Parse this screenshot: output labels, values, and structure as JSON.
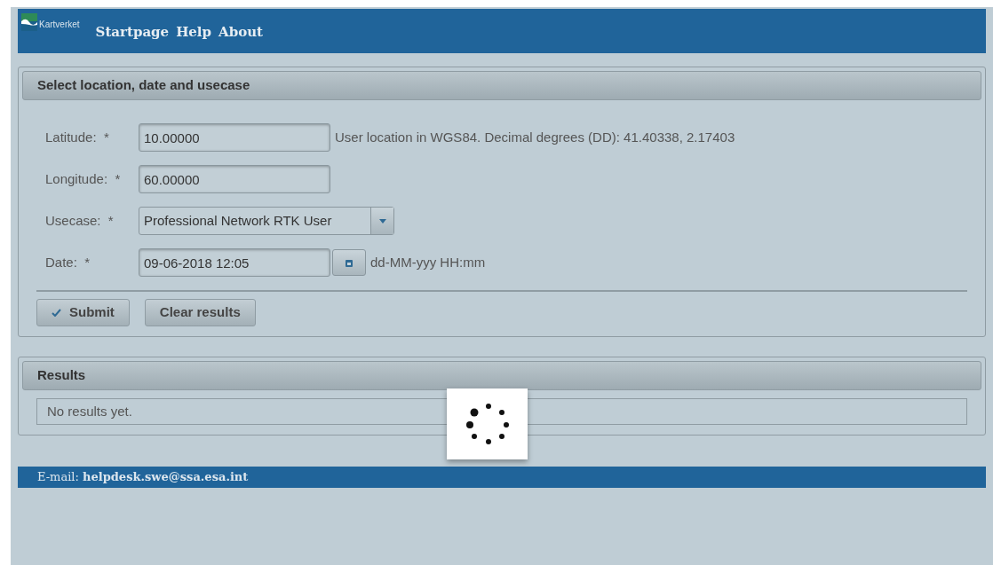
{
  "header": {
    "logo_text": "Kartverket",
    "nav": [
      "Startpage",
      "Help",
      "About"
    ]
  },
  "form_panel": {
    "title": "Select location, date and usecase",
    "fields": [
      {
        "kind": "text",
        "label": "Latitude:",
        "required_mark": "*",
        "value": "10.00000",
        "hint": "User location in WGS84. Decimal degrees (DD): 41.40338, 2.17403"
      },
      {
        "kind": "text",
        "label": "Longitude:",
        "required_mark": "*",
        "value": "60.00000"
      },
      {
        "kind": "select",
        "label": "Usecase:",
        "required_mark": "*",
        "value": "Professional Network RTK User"
      },
      {
        "kind": "date",
        "label": "Date:",
        "required_mark": "*",
        "value": "09-06-2018 12:05",
        "hint": "dd-MM-yyy HH:mm"
      }
    ],
    "buttons": [
      {
        "kind": "submit",
        "label": "Submit"
      },
      {
        "kind": "plain",
        "label": "Clear results"
      }
    ]
  },
  "results_panel": {
    "title": "Results",
    "message": "No results yet."
  },
  "loading": true,
  "footer": {
    "text": "E-mail: **helpdesk.swe@ssa.esa.int**"
  }
}
